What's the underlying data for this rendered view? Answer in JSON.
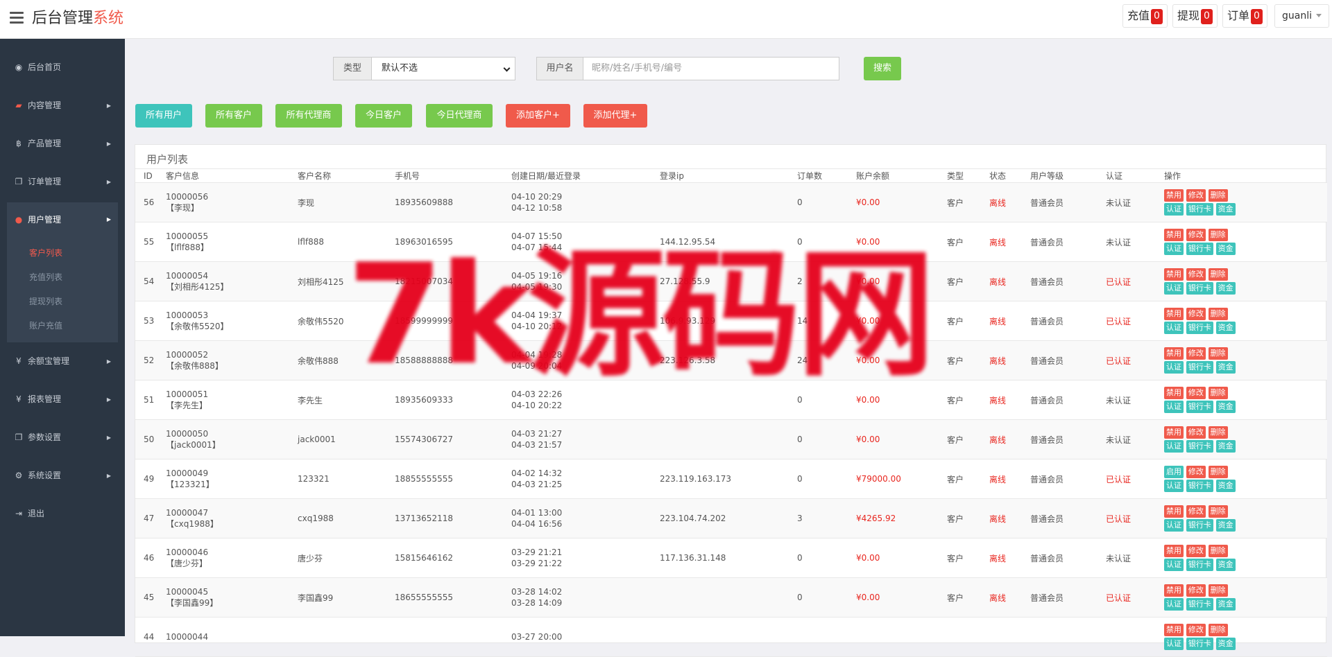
{
  "header": {
    "brand_main": "后台管理",
    "brand_accent": "系统",
    "recharge_label": "充值",
    "recharge_count": "0",
    "withdraw_label": "提现",
    "withdraw_count": "0",
    "order_label": "订单",
    "order_count": "0",
    "user_name": "guanli"
  },
  "sidebar": {
    "home": "后台首页",
    "content": "内容管理",
    "product": "产品管理",
    "order": "订单管理",
    "user": "用户管理",
    "sub": [
      "客户列表",
      "充值列表",
      "提现列表",
      "账户充值"
    ],
    "balance": "余额宝管理",
    "report": "报表管理",
    "params": "参数设置",
    "system": "系统设置",
    "logout": "退出"
  },
  "search": {
    "type_label": "类型",
    "type_value": "默认不选",
    "user_label": "用户名",
    "user_placeholder": "昵称/姓名/手机号/编号",
    "button": "搜索"
  },
  "filters": [
    "所有用户",
    "所有客户",
    "所有代理商",
    "今日客户",
    "今日代理商",
    "添加客户+",
    "添加代理+"
  ],
  "panel": {
    "title": "用户列表",
    "columns": [
      "ID",
      "客户信息",
      "客户名称",
      "手机号",
      "创建日期/最近登录",
      "登录ip",
      "订单数",
      "账户余额",
      "类型",
      "状态",
      "用户等级",
      "认证",
      "操作"
    ]
  },
  "ops": {
    "ban": "禁用",
    "enable": "启用",
    "edit": "修改",
    "delete": "删除",
    "verify": "认证",
    "bank": "银行卡",
    "funds": "资金"
  },
  "rows": [
    {
      "id": "56",
      "code": "10000056",
      "nick": "【李现】",
      "name": "李现",
      "phone": "18935609888",
      "created": "04-10 20:29",
      "last": "04-12 10:58",
      "ip": "",
      "orders": "0",
      "balance": "¥0.00",
      "type": "客户",
      "status": "离线",
      "level": "普通会员",
      "auth": "未认证",
      "auth_ok": false,
      "toggle": "禁用"
    },
    {
      "id": "55",
      "code": "10000055",
      "nick": "【lflf888】",
      "name": "lflf888",
      "phone": "18963016595",
      "created": "04-07 15:50",
      "last": "04-07 15:44",
      "ip": "144.12.95.54",
      "orders": "0",
      "balance": "¥0.00",
      "type": "客户",
      "status": "离线",
      "level": "普通会员",
      "auth": "未认证",
      "auth_ok": false,
      "toggle": "禁用"
    },
    {
      "id": "54",
      "code": "10000054",
      "nick": "【刘相彤4125】",
      "name": "刘相彤4125",
      "phone": "18215007034",
      "created": "04-05 19:16",
      "last": "04-05 19:30",
      "ip": "27.128.55.9",
      "orders": "2",
      "balance": "¥0.00",
      "type": "客户",
      "status": "离线",
      "level": "普通会员",
      "auth": "已认证",
      "auth_ok": true,
      "toggle": "禁用"
    },
    {
      "id": "53",
      "code": "10000053",
      "nick": "【余敬伟5520】",
      "name": "余敬伟5520",
      "phone": "18599999999",
      "created": "04-04 19:37",
      "last": "04-10 20:12",
      "ip": "106.9.93.129",
      "orders": "14",
      "balance": "¥0.00",
      "type": "客户",
      "status": "离线",
      "level": "普通会员",
      "auth": "已认证",
      "auth_ok": true,
      "toggle": "禁用"
    },
    {
      "id": "52",
      "code": "10000052",
      "nick": "【余敬伟888】",
      "name": "余敬伟888",
      "phone": "18588888888",
      "created": "04-04 19:28",
      "last": "04-09 20:04",
      "ip": "223.126.3.58",
      "orders": "24",
      "balance": "¥0.00",
      "type": "客户",
      "status": "离线",
      "level": "普通会员",
      "auth": "已认证",
      "auth_ok": true,
      "toggle": "禁用"
    },
    {
      "id": "51",
      "code": "10000051",
      "nick": "【李先生】",
      "name": "李先生",
      "phone": "18935609333",
      "created": "04-03 22:26",
      "last": "04-10 20:22",
      "ip": "",
      "orders": "0",
      "balance": "¥0.00",
      "type": "客户",
      "status": "离线",
      "level": "普通会员",
      "auth": "未认证",
      "auth_ok": false,
      "toggle": "禁用"
    },
    {
      "id": "50",
      "code": "10000050",
      "nick": "【jack0001】",
      "name": "jack0001",
      "phone": "15574306727",
      "created": "04-03 21:27",
      "last": "04-03 21:57",
      "ip": "",
      "orders": "0",
      "balance": "¥0.00",
      "type": "客户",
      "status": "离线",
      "level": "普通会员",
      "auth": "未认证",
      "auth_ok": false,
      "toggle": "禁用"
    },
    {
      "id": "49",
      "code": "10000049",
      "nick": "【123321】",
      "name": "123321",
      "phone": "18855555555",
      "created": "04-02 14:32",
      "last": "04-03 21:25",
      "ip": "223.119.163.173",
      "orders": "0",
      "balance": "¥79000.00",
      "type": "客户",
      "status": "离线",
      "level": "普通会员",
      "auth": "已认证",
      "auth_ok": true,
      "toggle": "启用"
    },
    {
      "id": "47",
      "code": "10000047",
      "nick": "【cxq1988】",
      "name": "cxq1988",
      "phone": "13713652118",
      "created": "04-01 13:00",
      "last": "04-04 16:56",
      "ip": "223.104.74.202",
      "orders": "3",
      "balance": "¥4265.92",
      "type": "客户",
      "status": "离线",
      "level": "普通会员",
      "auth": "已认证",
      "auth_ok": true,
      "toggle": "禁用"
    },
    {
      "id": "46",
      "code": "10000046",
      "nick": "【唐少芬】",
      "name": "唐少芬",
      "phone": "15815646162",
      "created": "03-29 21:21",
      "last": "03-29 21:22",
      "ip": "117.136.31.148",
      "orders": "0",
      "balance": "¥0.00",
      "type": "客户",
      "status": "离线",
      "level": "普通会员",
      "auth": "未认证",
      "auth_ok": false,
      "toggle": "禁用"
    },
    {
      "id": "45",
      "code": "10000045",
      "nick": "【李国鑫99】",
      "name": "李国鑫99",
      "phone": "18655555555",
      "created": "03-28 14:02",
      "last": "03-28 14:09",
      "ip": "",
      "orders": "0",
      "balance": "¥0.00",
      "type": "客户",
      "status": "离线",
      "level": "普通会员",
      "auth": "已认证",
      "auth_ok": true,
      "toggle": "禁用"
    },
    {
      "id": "44",
      "code": "10000044",
      "nick": "",
      "name": "",
      "phone": "",
      "created": "03-27 20:00",
      "last": "",
      "ip": "",
      "orders": "",
      "balance": "",
      "type": "",
      "status": "",
      "level": "",
      "auth": "",
      "auth_ok": false,
      "toggle": "禁用"
    }
  ],
  "watermark": "7k源码网",
  "colors": {
    "accent": "#f05a4b",
    "sidebar": "#2b3643",
    "green": "#77c94d",
    "teal": "#3ec4bb",
    "red": "#e8261f"
  }
}
